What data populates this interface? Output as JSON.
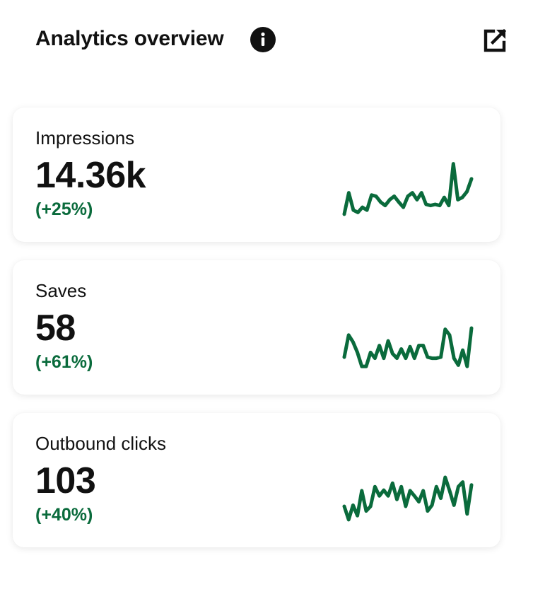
{
  "header": {
    "title": "Analytics overview",
    "info_icon": "info-icon",
    "external_icon": "external-link-icon"
  },
  "colors": {
    "accent": "#0a6b3c",
    "text": "#111111",
    "background": "#ffffff"
  },
  "cards": [
    {
      "label": "Impressions",
      "value": "14.36k",
      "change": "(+25%)",
      "trend": [
        0.05,
        0.42,
        0.12,
        0.08,
        0.17,
        0.12,
        0.38,
        0.36,
        0.26,
        0.2,
        0.3,
        0.36,
        0.26,
        0.17,
        0.36,
        0.42,
        0.3,
        0.42,
        0.22,
        0.2,
        0.22,
        0.2,
        0.34,
        0.2,
        0.92,
        0.3,
        0.34,
        0.44,
        0.66
      ]
    },
    {
      "label": "Saves",
      "value": "58",
      "change": "(+61%)",
      "trend": [
        0.22,
        0.6,
        0.48,
        0.3,
        0.06,
        0.06,
        0.3,
        0.2,
        0.42,
        0.2,
        0.5,
        0.28,
        0.2,
        0.36,
        0.2,
        0.4,
        0.2,
        0.42,
        0.42,
        0.22,
        0.2,
        0.2,
        0.22,
        0.7,
        0.6,
        0.2,
        0.08,
        0.34,
        0.06,
        0.72
      ]
    },
    {
      "label": "Outbound clicks",
      "value": "103",
      "change": "(+40%)",
      "trend": [
        0.28,
        0.05,
        0.3,
        0.12,
        0.55,
        0.2,
        0.28,
        0.62,
        0.46,
        0.56,
        0.46,
        0.68,
        0.4,
        0.62,
        0.28,
        0.55,
        0.46,
        0.36,
        0.55,
        0.2,
        0.3,
        0.62,
        0.42,
        0.78,
        0.55,
        0.3,
        0.62,
        0.7,
        0.15,
        0.65
      ]
    }
  ]
}
